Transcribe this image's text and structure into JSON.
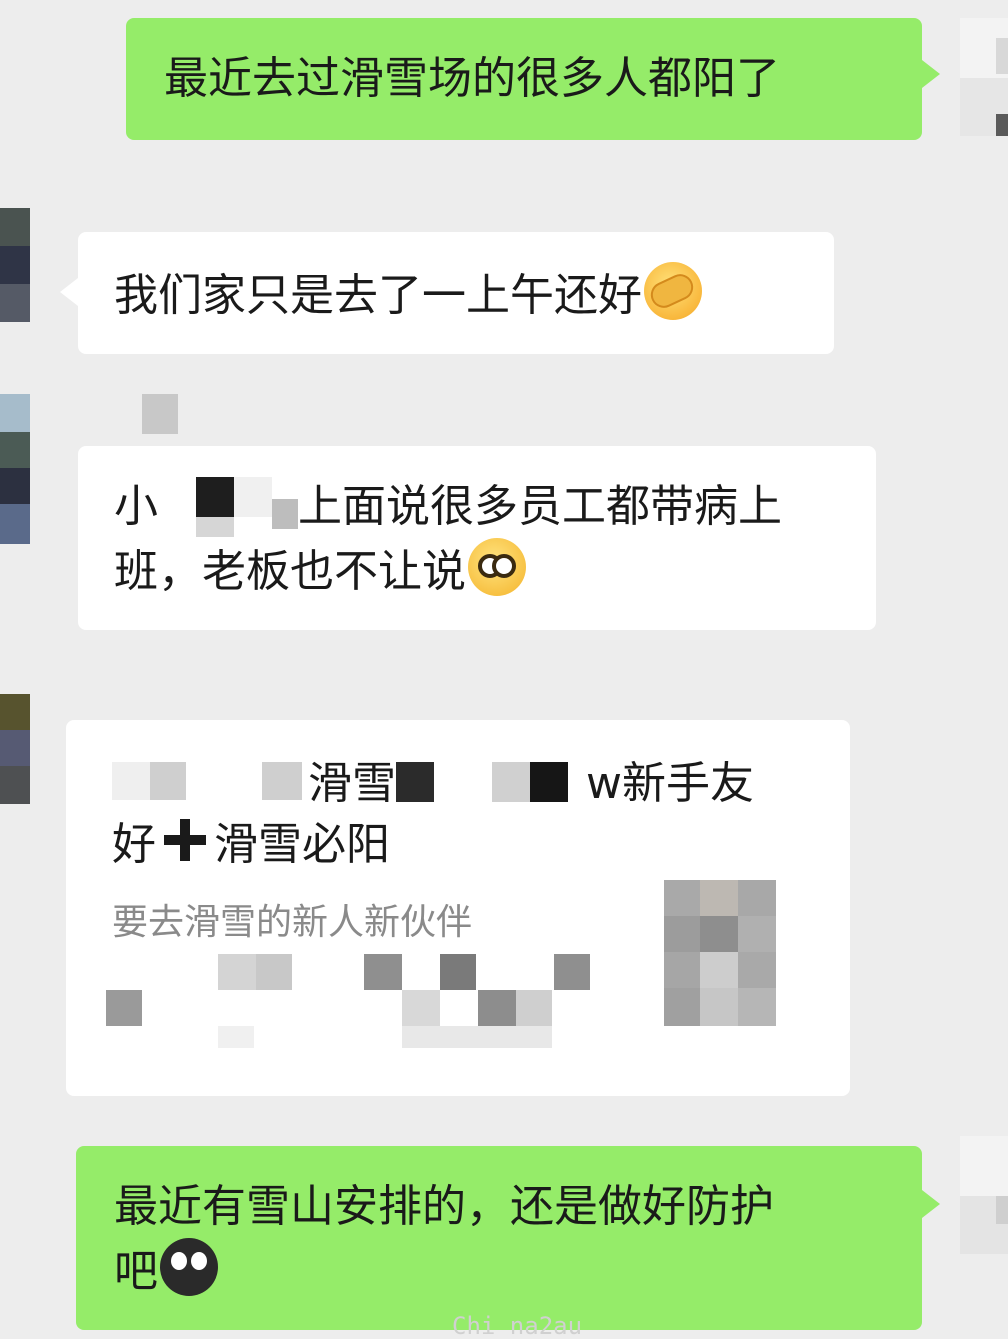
{
  "messages": {
    "m1": {
      "text": "最近去过滑雪场的很多人都阳了"
    },
    "m2": {
      "text": "我们家只是去了一上午还好",
      "emoji": "facepalm-emoji"
    },
    "m3": {
      "line1_a": "小",
      "line1_b": "上面说很多员工都带病上",
      "line2": "班，老板也不让说",
      "emoji": "pleading-emoji"
    },
    "m4": {
      "line1_a": "滑雪",
      "line1_b": "w新手友",
      "line2_a": "好",
      "line2_b": "滑雪必阳",
      "subtitle": "要去滑雪的新人新伙伴",
      "plus_icon": "plus-icon"
    },
    "m5": {
      "line1": "最近有雪山安排的，还是做好防护",
      "line2": "吧",
      "emoji": "scared-crying-emoji"
    }
  },
  "watermark": "Chi na2au",
  "colors": {
    "green_bubble": "#95ec69",
    "white_bubble": "#ffffff",
    "background": "#ededed"
  }
}
